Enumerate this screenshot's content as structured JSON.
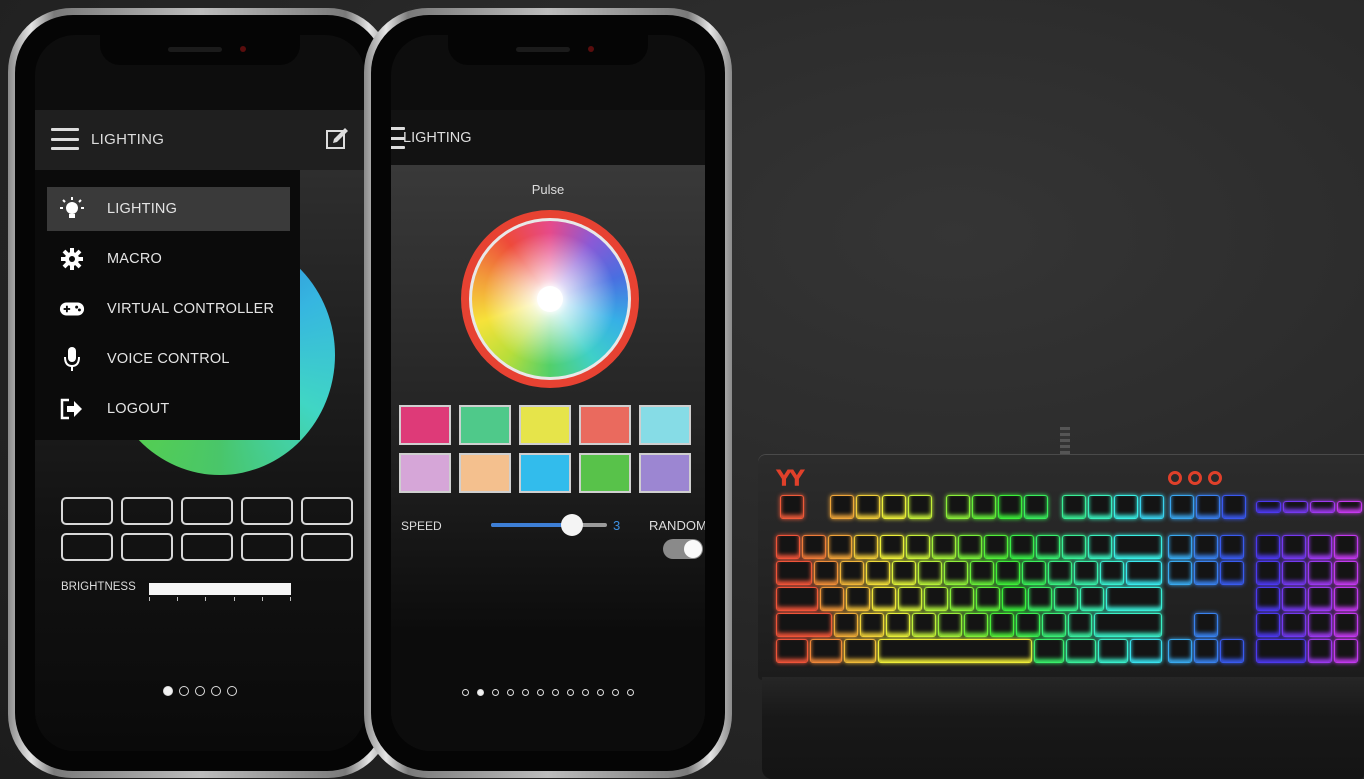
{
  "phone1": {
    "appbar_title": "LIGHTING",
    "menu": [
      {
        "label": "LIGHTING",
        "icon": "lightbulb-icon",
        "active": true
      },
      {
        "label": "MACRO",
        "icon": "gear-icon",
        "active": false
      },
      {
        "label": "VIRTUAL CONTROLLER",
        "icon": "gamepad-icon",
        "active": false
      },
      {
        "label": "VOICE CONTROL",
        "icon": "microphone-icon",
        "active": false
      },
      {
        "label": "LOGOUT",
        "icon": "logout-icon",
        "active": false
      }
    ],
    "brightness_label": "BRIGHTNESS",
    "brightness_level": 1.0,
    "page_count": 5,
    "page_active": 0
  },
  "phone2": {
    "appbar_title": "LIGHTING",
    "effect_label": "Pulse",
    "swatch_colors": [
      "#de3a78",
      "#4fc98a",
      "#e6e44a",
      "#ea6a5e",
      "#86dce6",
      "#d6a6d8",
      "#f4c08e",
      "#32bcec",
      "#58c24a",
      "#9c86d2"
    ],
    "speed_label": "SPEED",
    "speed_value": "3",
    "speed_fraction": 0.7,
    "random_label": "RANDOM",
    "random_on": true,
    "page_count": 12,
    "page_active": 1
  },
  "colors": {
    "accent_red": "#e74232",
    "accent_blue": "#3d8fe0",
    "battery_green": "#53d36a"
  }
}
